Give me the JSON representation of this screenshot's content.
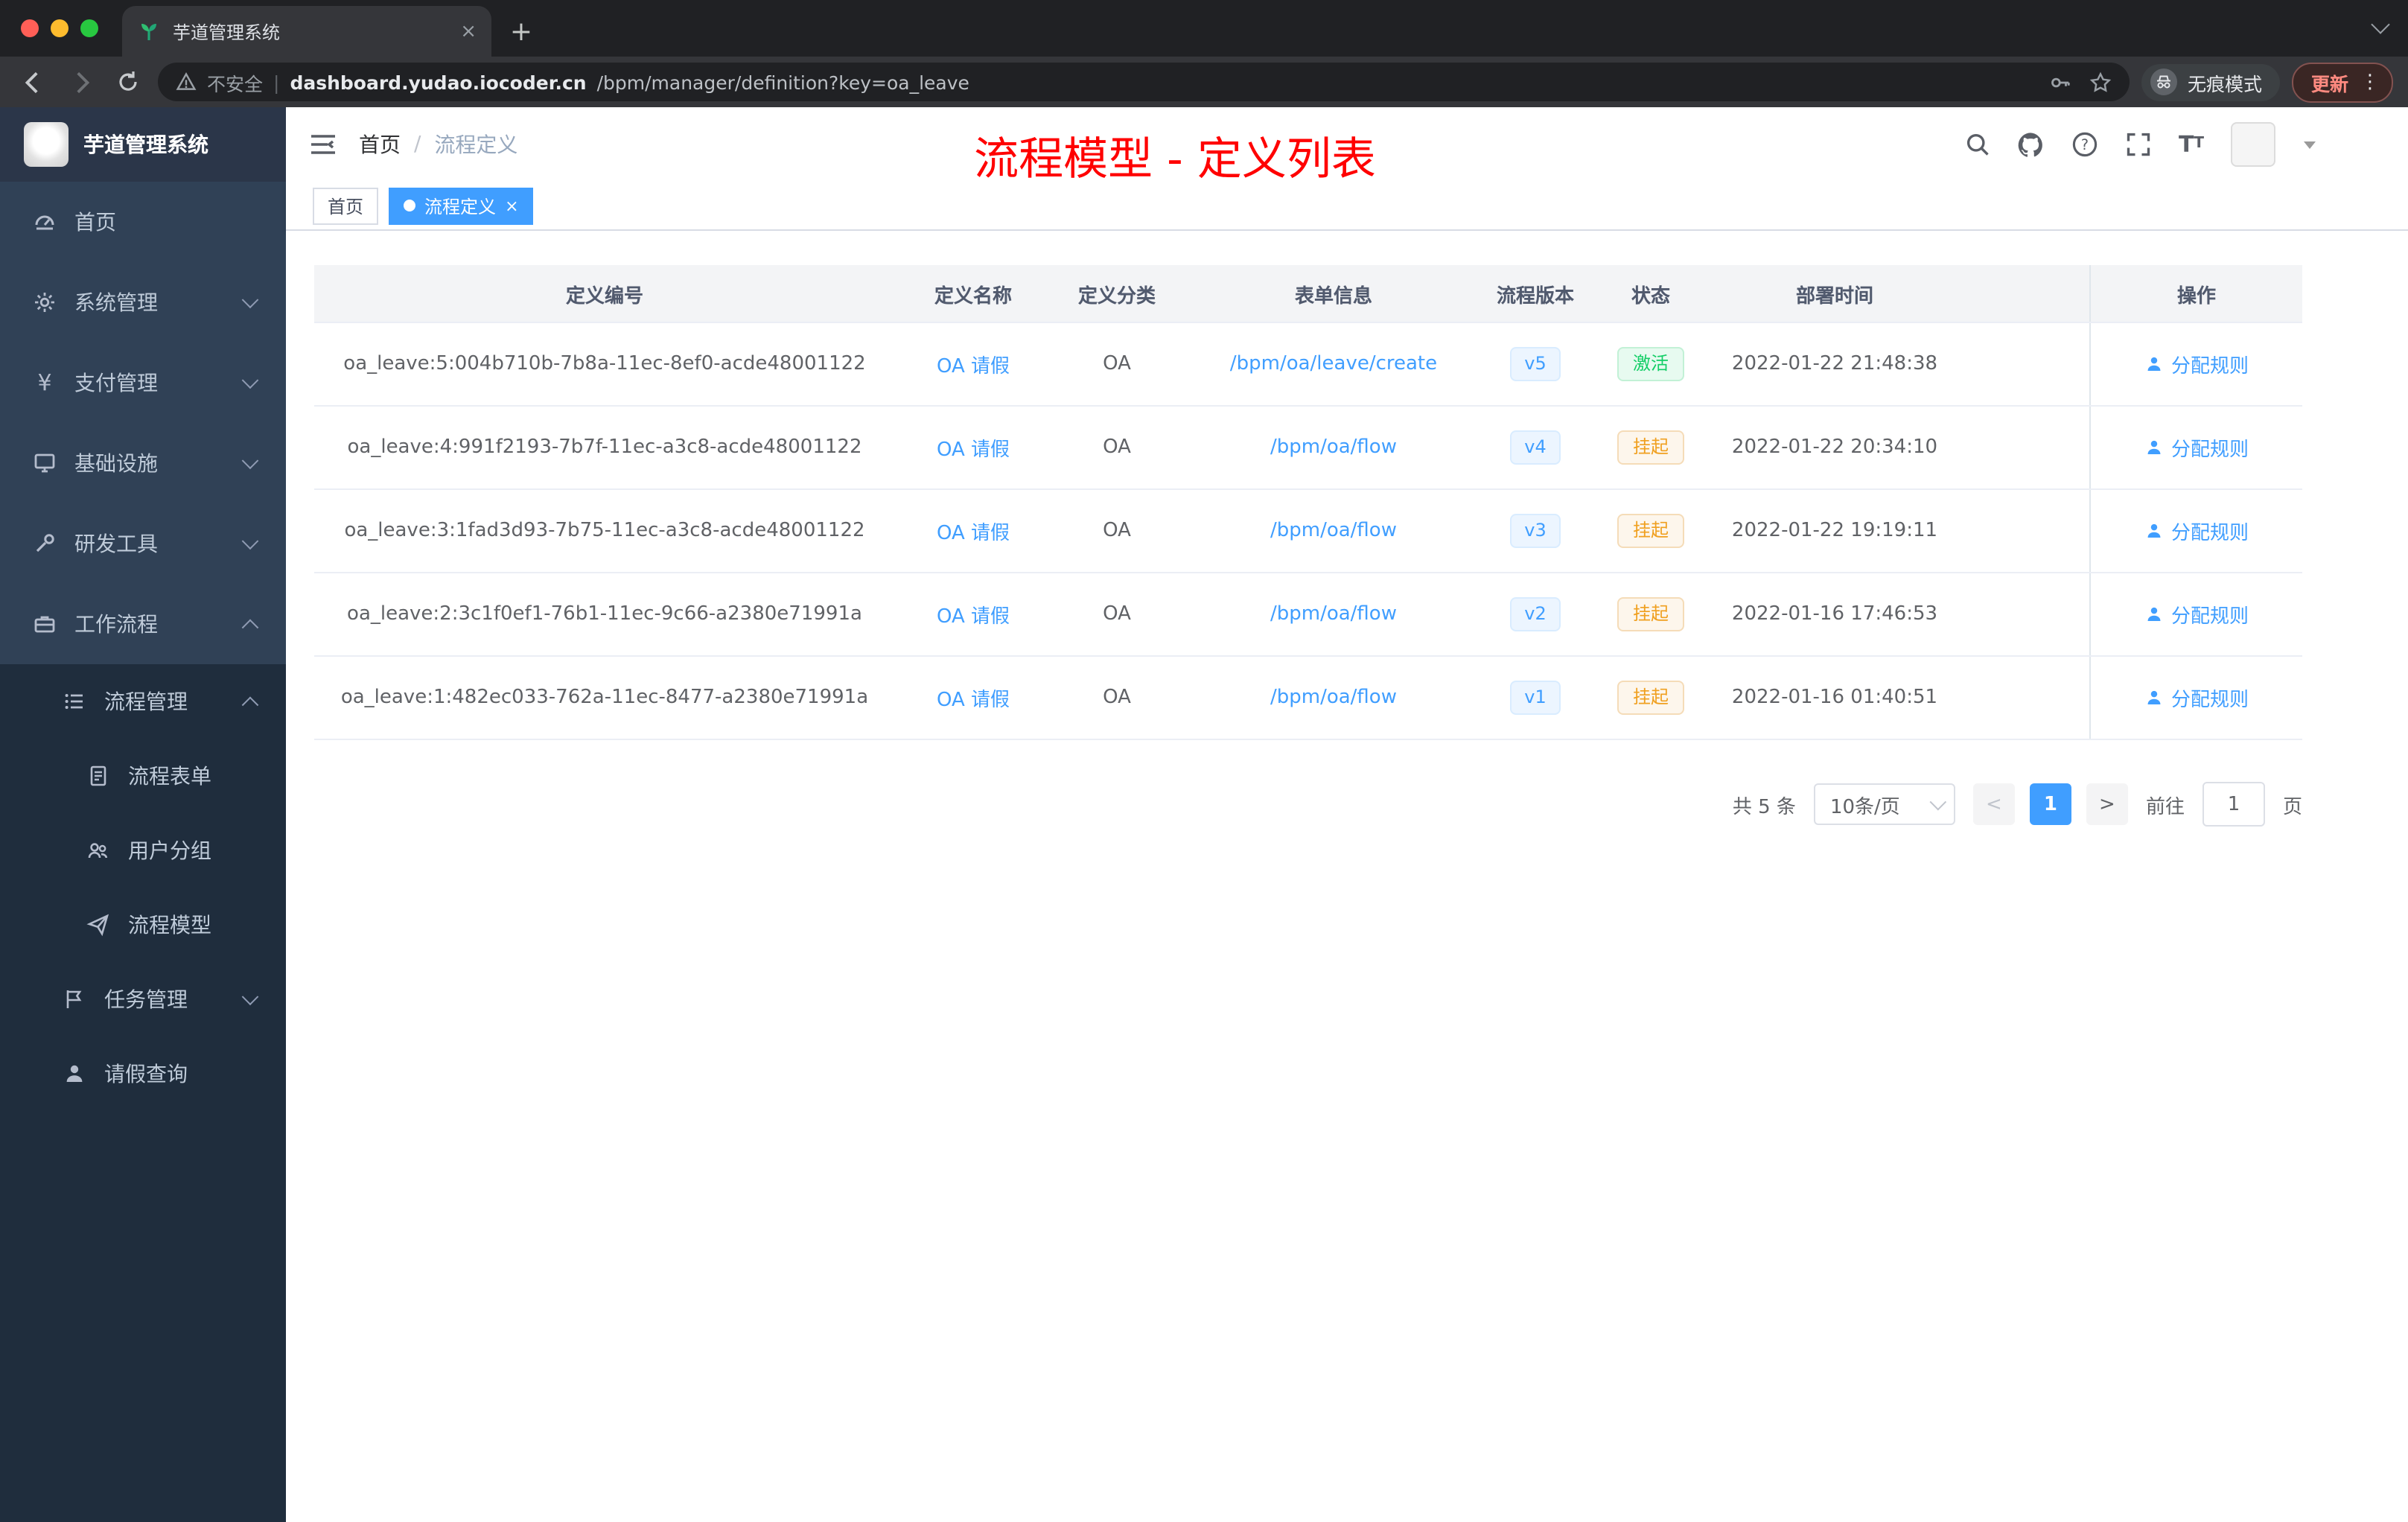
{
  "browser": {
    "tab_title": "芋道管理系统",
    "security_label": "不安全",
    "url_domain": "dashboard.yudao.iocoder.cn",
    "url_path": "/bpm/manager/definition?key=oa_leave",
    "incognito_label": "无痕模式",
    "update_label": "更新",
    "kebab": "⋮",
    "new_tab": "+",
    "close_tab": "×",
    "colors": {
      "red": "#ff5f57",
      "yellow": "#febc2e",
      "green": "#28c840"
    }
  },
  "sidebar": {
    "logo_title": "芋道管理系统",
    "items": [
      {
        "label": "首页"
      },
      {
        "label": "系统管理"
      },
      {
        "label": "支付管理"
      },
      {
        "label": "基础设施"
      },
      {
        "label": "研发工具"
      },
      {
        "label": "工作流程"
      },
      {
        "label": "流程管理"
      },
      {
        "label": "流程表单"
      },
      {
        "label": "用户分组"
      },
      {
        "label": "流程模型"
      },
      {
        "label": "任务管理"
      },
      {
        "label": "请假查询"
      }
    ],
    "yen_glyph": "¥"
  },
  "header": {
    "breadcrumb_home": "首页",
    "breadcrumb_sep": "/",
    "breadcrumb_current": "流程定义",
    "annotation": "流程模型 - 定义列表"
  },
  "tags": {
    "home": "首页",
    "active": "流程定义",
    "close": "×"
  },
  "table": {
    "columns": [
      "定义编号",
      "定义名称",
      "定义分类",
      "表单信息",
      "流程版本",
      "状态",
      "部署时间",
      "操作"
    ],
    "rows": [
      {
        "id": "oa_leave:5:004b710b-7b8a-11ec-8ef0-acde48001122",
        "name": "OA 请假",
        "category": "OA",
        "form": "/bpm/oa/leave/create",
        "version": "v5",
        "status": "激活",
        "time": "2022-01-22 21:48:38",
        "action": "分配规则"
      },
      {
        "id": "oa_leave:4:991f2193-7b7f-11ec-a3c8-acde48001122",
        "name": "OA 请假",
        "category": "OA",
        "form": "/bpm/oa/flow",
        "version": "v4",
        "status": "挂起",
        "time": "2022-01-22 20:34:10",
        "action": "分配规则"
      },
      {
        "id": "oa_leave:3:1fad3d93-7b75-11ec-a3c8-acde48001122",
        "name": "OA 请假",
        "category": "OA",
        "form": "/bpm/oa/flow",
        "version": "v3",
        "status": "挂起",
        "time": "2022-01-22 19:19:11",
        "action": "分配规则"
      },
      {
        "id": "oa_leave:2:3c1f0ef1-76b1-11ec-9c66-a2380e71991a",
        "name": "OA 请假",
        "category": "OA",
        "form": "/bpm/oa/flow",
        "version": "v2",
        "status": "挂起",
        "time": "2022-01-16 17:46:53",
        "action": "分配规则"
      },
      {
        "id": "oa_leave:1:482ec033-762a-11ec-8477-a2380e71991a",
        "name": "OA 请假",
        "category": "OA",
        "form": "/bpm/oa/flow",
        "version": "v1",
        "status": "挂起",
        "time": "2022-01-16 01:40:51",
        "action": "分配规则"
      }
    ]
  },
  "pagination": {
    "total": "共 5 条",
    "page_size": "10条/页",
    "prev": "<",
    "page": "1",
    "next": ">",
    "jump_label": "前往",
    "jump_value": "1",
    "jump_unit": "页"
  }
}
